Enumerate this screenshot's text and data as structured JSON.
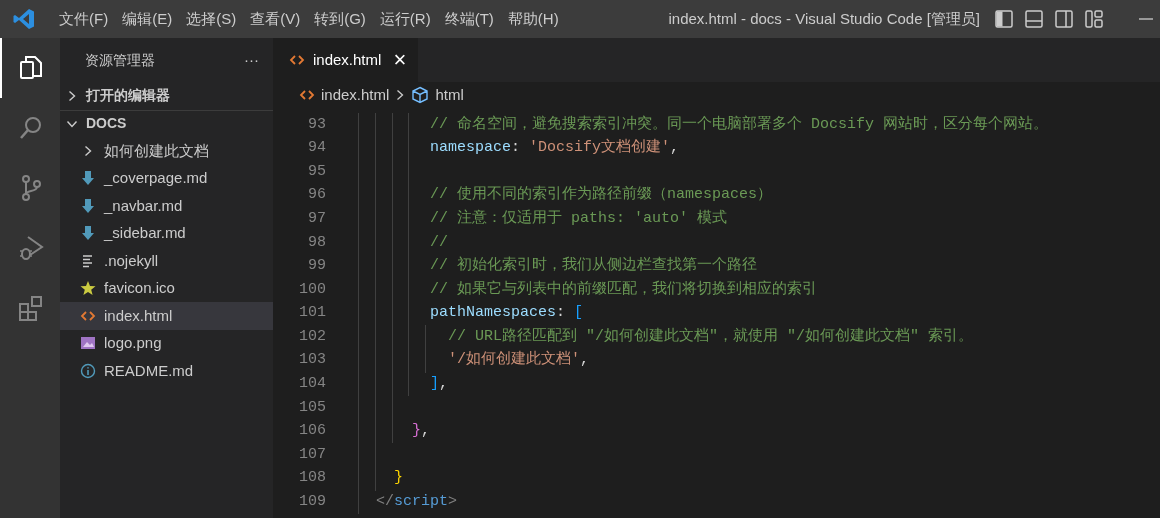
{
  "title_bar": {
    "menus": [
      "文件(F)",
      "编辑(E)",
      "选择(S)",
      "查看(V)",
      "转到(G)",
      "运行(R)",
      "终端(T)",
      "帮助(H)"
    ],
    "title": "index.html - docs - Visual Studio Code [管理员]",
    "layout_toggles": [
      {
        "kind": "primary-sidebar",
        "on": true
      },
      {
        "kind": "panel",
        "on": false
      },
      {
        "kind": "secondary-sidebar",
        "on": false
      },
      {
        "kind": "customize"
      }
    ]
  },
  "activity_bar": [
    {
      "kind": "explorer",
      "selected": true
    },
    {
      "kind": "search",
      "selected": false
    },
    {
      "kind": "source-control",
      "selected": false
    },
    {
      "kind": "run-debug",
      "selected": false
    },
    {
      "kind": "extensions",
      "selected": false
    }
  ],
  "sidebar": {
    "title": "资源管理器",
    "more": "···",
    "sections": [
      {
        "label": "打开的编辑器",
        "expanded": false
      },
      {
        "label": "DOCS",
        "expanded": true,
        "children": [
          {
            "label": "如何创建此文档",
            "kind": "folder",
            "expanded": false,
            "selected": false
          },
          {
            "label": "_coverpage.md",
            "kind": "markdown",
            "selected": false
          },
          {
            "label": "_navbar.md",
            "kind": "markdown",
            "selected": false
          },
          {
            "label": "_sidebar.md",
            "kind": "markdown",
            "selected": false
          },
          {
            "label": ".nojekyll",
            "kind": "text",
            "selected": false
          },
          {
            "label": "favicon.ico",
            "kind": "favicon",
            "selected": false
          },
          {
            "label": "index.html",
            "kind": "html",
            "selected": true
          },
          {
            "label": "logo.png",
            "kind": "image",
            "selected": false
          },
          {
            "label": "README.md",
            "kind": "info",
            "selected": false
          }
        ]
      }
    ]
  },
  "editor": {
    "tabs": [
      {
        "label": "index.html",
        "kind": "html",
        "selected": true,
        "close": "×"
      }
    ],
    "breadcrumb": [
      {
        "label": "index.html",
        "kind": "html"
      },
      {
        "label": "html",
        "kind": "element"
      }
    ],
    "lines": [
      {
        "number": "93",
        "tokens": [
          {
            "kind": "comment",
            "text": "        // 命名空间，避免搜索索引冲突。同一个电脑部署多个 Docsify 网站时，区分每个网站。"
          }
        ]
      },
      {
        "number": "94",
        "tokens": [
          {
            "kind": "property",
            "text": "        namespace"
          },
          {
            "kind": "punct",
            "text": ": "
          },
          {
            "kind": "string",
            "text": "'Docsify文档创建'"
          },
          {
            "kind": "punct",
            "text": ","
          }
        ]
      },
      {
        "number": "95"
      },
      {
        "number": "96",
        "tokens": [
          {
            "kind": "comment",
            "text": "        // 使用不同的索引作为路径前缀（namespaces）"
          }
        ]
      },
      {
        "number": "97",
        "tokens": [
          {
            "kind": "comment",
            "text": "        // 注意：仅适用于 paths: 'auto' 模式"
          }
        ]
      },
      {
        "number": "98",
        "tokens": [
          {
            "kind": "comment",
            "text": "        //"
          }
        ]
      },
      {
        "number": "99",
        "tokens": [
          {
            "kind": "comment",
            "text": "        // 初始化索引时，我们从侧边栏查找第一个路径"
          }
        ]
      },
      {
        "number": "100",
        "tokens": [
          {
            "kind": "comment",
            "text": "        // 如果它与列表中的前缀匹配，我们将切换到相应的索引"
          }
        ]
      },
      {
        "number": "101",
        "tokens": [
          {
            "kind": "property",
            "text": "        pathNamespaces"
          },
          {
            "kind": "punct",
            "text": ": "
          },
          {
            "kind": "bracket-blue",
            "text": "["
          }
        ]
      },
      {
        "number": "102",
        "tokens": [
          {
            "kind": "comment",
            "text": "          // URL路径匹配到 \"/如何创建此文档\"，就使用 \"/如何创建此文档\" 索引。"
          }
        ]
      },
      {
        "number": "103",
        "tokens": [
          {
            "kind": "string",
            "text": "          '/如何创建此文档'"
          },
          {
            "kind": "punct",
            "text": ","
          }
        ]
      },
      {
        "number": "104",
        "tokens": [
          {
            "kind": "bracket-blue",
            "text": "        ]"
          },
          {
            "kind": "punct",
            "text": ","
          }
        ]
      },
      {
        "number": "105"
      },
      {
        "number": "106",
        "tokens": [
          {
            "kind": "bracket-pink",
            "text": "      }"
          },
          {
            "kind": "punct",
            "text": ","
          }
        ]
      },
      {
        "number": "107"
      },
      {
        "number": "108",
        "tokens": [
          {
            "kind": "bracket-gold",
            "text": "    }"
          }
        ]
      },
      {
        "number": "109",
        "tokens": [
          {
            "kind": "tag-punct",
            "text": "  </"
          },
          {
            "kind": "tag",
            "text": "script"
          },
          {
            "kind": "tag-punct",
            "text": ">"
          }
        ]
      }
    ]
  }
}
